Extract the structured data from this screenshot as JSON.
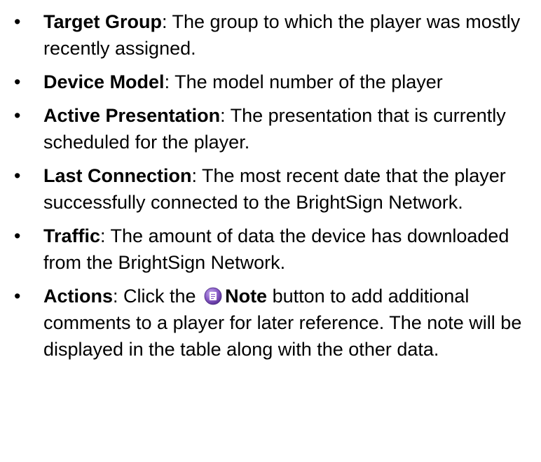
{
  "items": [
    {
      "term": "Target Group",
      "text": ": The group to which the player was mostly recently assigned."
    },
    {
      "term": "Device Model",
      "text": ": The model number of the player"
    },
    {
      "term": "Active Presentation",
      "text": ": The presentation that is currently scheduled for the player."
    },
    {
      "term": "Last Connection",
      "text": ": The most recent date that the player successfully connected to the BrightSign Network."
    },
    {
      "term": "Traffic",
      "text": ": The amount of data the device has downloaded from the BrightSign Network."
    },
    {
      "term": "Actions",
      "text_before_icon": ": Click the",
      "icon": "note-icon",
      "button_label": "Note",
      "text_after_button": " button to add additional comments to a player for later reference. The note will be displayed in the table along with the other data."
    }
  ],
  "bullet": "•",
  "colors": {
    "text": "#000000",
    "note_icon": "#8a5cc8"
  }
}
